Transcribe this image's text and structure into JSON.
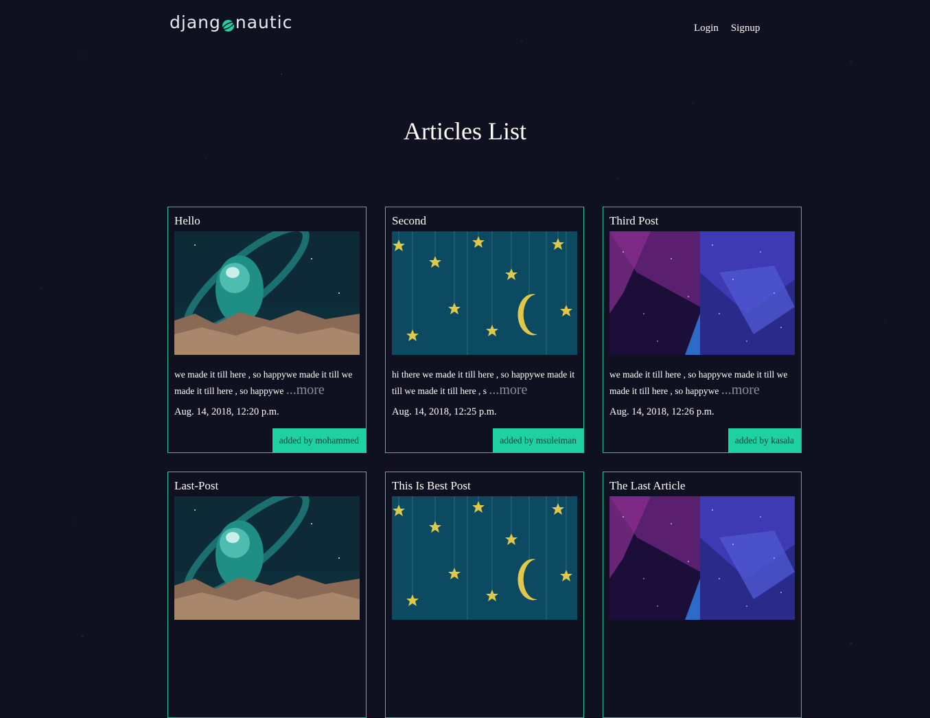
{
  "header": {
    "logo_left": "djang",
    "logo_right": "nautic",
    "nav": [
      {
        "label": "Login"
      },
      {
        "label": "Signup"
      }
    ]
  },
  "page_title": "Articles List",
  "colors": {
    "accent": "#1fd1a0",
    "border": "#1fc79b",
    "background": "#0f1120"
  },
  "articles": [
    {
      "title": "Hello",
      "image": "planet",
      "excerpt": "we made it till here , so happywe made it till we made it till here , so happywe ",
      "more": "...more",
      "date": "Aug. 14, 2018, 12:20 p.m.",
      "author": "added by mohammed"
    },
    {
      "title": "Second",
      "image": "stars-moon",
      "excerpt": "hi there we made it till here , so happywe made it till we made it till here , s ",
      "more": "...more",
      "date": "Aug. 14, 2018, 12:25 p.m.",
      "author": "added by msuleiman"
    },
    {
      "title": "Third Post",
      "image": "nebula",
      "excerpt": "we made it till here , so happywe made it till we made it till here , so happywe ",
      "more": "...more",
      "date": "Aug. 14, 2018, 12:26 p.m.",
      "author": "added by kasala"
    },
    {
      "title": "Last-Post",
      "image": "planet"
    },
    {
      "title": "This Is Best Post",
      "image": "stars-moon"
    },
    {
      "title": "The Last Article",
      "image": "nebula"
    }
  ]
}
